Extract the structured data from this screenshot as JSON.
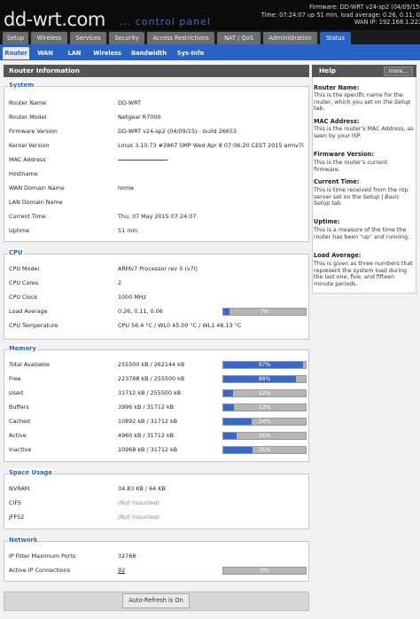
{
  "header": {
    "logo": "dd-wrt.com",
    "subtitle": "... control panel",
    "firmware": "Firmware: DD-WRT v24-sp2 (04/09/15)",
    "time_load": "Time: 07:24:07 up 51 min, load average: 0.26, 0.11, 0.",
    "wan_ip": "WAN IP: 192.168.1.223"
  },
  "main_nav": [
    {
      "label": "Setup",
      "active": false
    },
    {
      "label": "Wireless",
      "active": false
    },
    {
      "label": "Services",
      "active": false
    },
    {
      "label": "Security",
      "active": false
    },
    {
      "label": "Access Restrictions",
      "active": false
    },
    {
      "label": "NAT / QoS",
      "active": false
    },
    {
      "label": "Administration",
      "active": false
    },
    {
      "label": "Status",
      "active": true
    }
  ],
  "sub_nav": [
    {
      "label": "Router",
      "active": true
    },
    {
      "label": "WAN",
      "active": false
    },
    {
      "label": "LAN",
      "active": false
    },
    {
      "label": "Wireless",
      "active": false
    },
    {
      "label": "Bandwidth",
      "active": false
    },
    {
      "label": "Sys-Info",
      "active": false
    }
  ],
  "page_title": "Router Information",
  "system": {
    "legend": "System",
    "rows": [
      {
        "label": "Router Name",
        "value": "DD-WRT"
      },
      {
        "label": "Router Model",
        "value": "Netgear R7000"
      },
      {
        "label": "Firmware Version",
        "value": "DD-WRT v24-sp2 (04/09/15) - build 26653"
      },
      {
        "label": "Kernel Version",
        "value": "Linux 3.10.73 #3867 SMP Wed Apr 8 07:06:20 CEST 2015 armv7l"
      },
      {
        "label": "MAC Address",
        "value": ""
      },
      {
        "label": "Hostname",
        "value": ""
      },
      {
        "label": "WAN Domain Name",
        "value": "home"
      },
      {
        "label": "LAN Domain Name",
        "value": ""
      },
      {
        "label": "Current Time",
        "value": "Thu, 07 May 2015 07:24:07"
      },
      {
        "label": "Uptime",
        "value": "51 min"
      }
    ]
  },
  "cpu": {
    "legend": "CPU",
    "rows": [
      {
        "label": "CPU Model",
        "value": "ARMv7 Processor rev 0 (v7l)"
      },
      {
        "label": "CPU Cores",
        "value": "2"
      },
      {
        "label": "CPU Clock",
        "value": "1000 MHz"
      },
      {
        "label": "Load Average",
        "value": "0.26, 0.11, 0.06",
        "percent": 7,
        "percent_text": "7%"
      },
      {
        "label": "CPU Temperature",
        "value": "CPU 56.4 °C / WL0 45.00 °C / WL1 46.13 °C"
      }
    ]
  },
  "memory": {
    "legend": "Memory",
    "rows": [
      {
        "label": "Total Available",
        "value": "255500 kB / 262144 kB",
        "percent": 97,
        "percent_text": "97%"
      },
      {
        "label": "Free",
        "value": "223788 kB / 255500 kB",
        "percent": 88,
        "percent_text": "88%"
      },
      {
        "label": "Used",
        "value": "31712 kB / 255500 kB",
        "percent": 12,
        "percent_text": "12%"
      },
      {
        "label": "Buffers",
        "value": "3996 kB / 31712 kB",
        "percent": 13,
        "percent_text": "13%"
      },
      {
        "label": "Cached",
        "value": "10892 kB / 31712 kB",
        "percent": 34,
        "percent_text": "34%"
      },
      {
        "label": "Active",
        "value": "4960 kB / 31712 kB",
        "percent": 16,
        "percent_text": "16%"
      },
      {
        "label": "Inactive",
        "value": "10968 kB / 31712 kB",
        "percent": 35,
        "percent_text": "35%"
      }
    ]
  },
  "space": {
    "legend": "Space Usage",
    "rows": [
      {
        "label": "NVRAM",
        "value": "34.83 KB / 64 KB"
      },
      {
        "label": "CIFS",
        "value": "(Not mounted)"
      },
      {
        "label": "JFFS2",
        "value": "(Not mounted)"
      }
    ]
  },
  "network": {
    "legend": "Network",
    "rows": [
      {
        "label": "IP Filter Maximum Ports",
        "value": "32768"
      },
      {
        "label": "Active IP Connections",
        "value": "92",
        "percent": 0,
        "percent_text": "0%"
      }
    ]
  },
  "help": {
    "title": "Help",
    "more": "more...",
    "items": [
      {
        "term": "Router Name:",
        "desc_before": "This is the specific name for the router, which you set on the ",
        "desc_em": "Setup",
        "desc_after": " tab."
      },
      {
        "term": "MAC Address:",
        "desc_before": "This is the router's MAC Address, as seen by your ISP.",
        "desc_em": "",
        "desc_after": ""
      },
      {
        "term": "Firmware Version:",
        "desc_before": "This is the router's current firmware.",
        "desc_em": "",
        "desc_after": ""
      },
      {
        "term": "Current Time:",
        "desc_before": "This is time received from the ntp server set on the ",
        "desc_em": "Setup | Basic Setup",
        "desc_after": " tab."
      },
      {
        "term": "Uptime:",
        "desc_before": "This is a measure of the time the router has been \"up\" and running.",
        "desc_em": "",
        "desc_after": ""
      },
      {
        "term": "Load Average:",
        "desc_before": "This is given as three numbers that represent the system load during the last one, five, and fifteen minute periods.",
        "desc_em": "",
        "desc_after": ""
      }
    ]
  },
  "footer": {
    "autorefresh_label": "Auto-Refresh is On"
  },
  "colors": {
    "accent": "#2a63c6",
    "header_bg": "#0b0b0b",
    "bar_fill": "#3b67c6"
  }
}
